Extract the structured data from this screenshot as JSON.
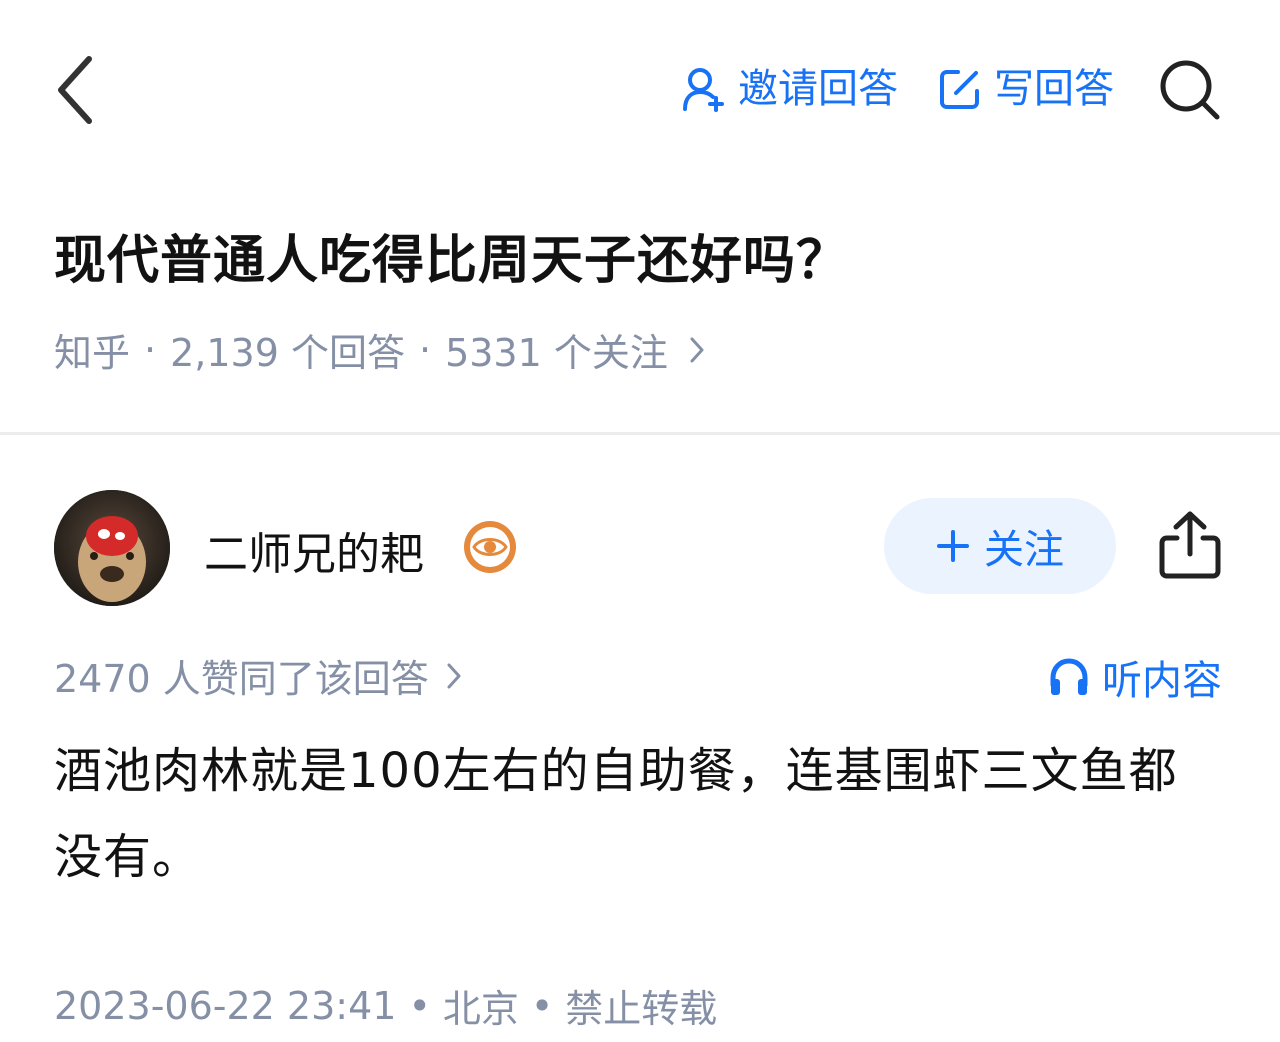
{
  "header": {
    "invite_label": "邀请回答",
    "write_label": "写回答"
  },
  "question": {
    "title": "现代普通人吃得比周天子还好吗？",
    "source": "知乎",
    "answers": "2,139 个回答",
    "followers": "5331 个关注"
  },
  "author": {
    "name": "二师兄的耙",
    "follow_label": "关注"
  },
  "answer": {
    "upvotes": "2470 人赞同了该回答",
    "listen_label": "听内容",
    "body": "酒池肉林就是100左右的自助餐，连基围虾三文鱼都没有。",
    "date": "2023-06-22 23:41",
    "location": "北京",
    "copyright": "禁止转载"
  },
  "colors": {
    "accent": "#1772f6",
    "muted": "#8590a6",
    "follow_bg": "#ebf3ff"
  }
}
